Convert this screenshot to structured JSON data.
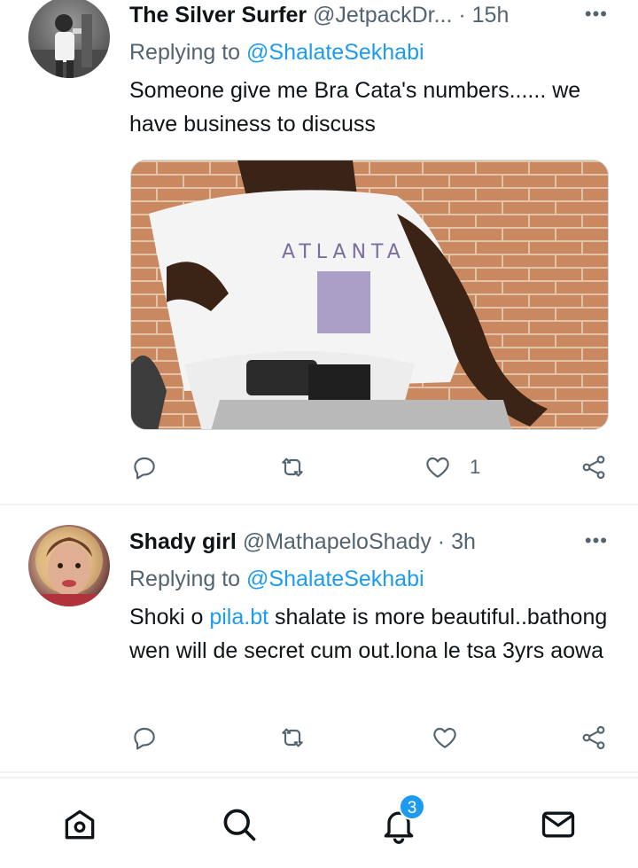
{
  "tweets": [
    {
      "display_name": "The Silver Surfer",
      "handle": "@JetpackDr...",
      "separator": "·",
      "time": "15h",
      "more": "•••",
      "replying_prefix": "Replying to",
      "replying_to": "@ShalateSekhabi",
      "text": "Someone give me Bra Cata's numbers...... we have business to discuss",
      "media_caption": "ATLANTA",
      "like_count": "1"
    },
    {
      "display_name": "Shady girl",
      "handle": "@MathapeloShady",
      "separator": "·",
      "time": "3h",
      "more": "•••",
      "replying_prefix": "Replying to",
      "replying_to": "@ShalateSekhabi",
      "text_before_link": "Shoki o ",
      "link": "pila.bt",
      "text_after_link": " shalate is more beautiful..bathong wen will de secret cum out.lona le tsa 3yrs aowa"
    }
  ],
  "nav": {
    "notification_badge": "3",
    "items": [
      "home-icon",
      "search-icon",
      "notifications-icon",
      "messages-icon"
    ]
  },
  "colors": {
    "accent": "#1d9bf0",
    "muted": "#536471",
    "text": "#0f1419",
    "divider": "#eff3f4"
  }
}
